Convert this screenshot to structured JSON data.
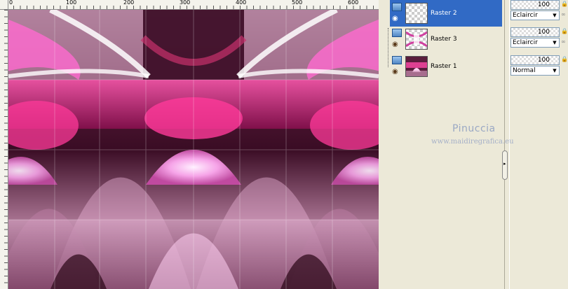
{
  "ruler": {
    "labels": [
      "0",
      "100",
      "200",
      "300",
      "400",
      "500",
      "600"
    ]
  },
  "layers": [
    {
      "name": "Raster 2",
      "selected": true,
      "opacity": "100",
      "blend": "Eclaircir"
    },
    {
      "name": "Raster 3",
      "selected": false,
      "opacity": "100",
      "blend": "Eclaircir"
    },
    {
      "name": "Raster 1",
      "selected": false,
      "opacity": "100",
      "blend": "Normal"
    }
  ],
  "watermark": {
    "name": "Pinuccia",
    "url": "www.maidiregrafica.eu"
  },
  "icons": {
    "layer": "raster-layer-icon",
    "eye": "eye-icon",
    "lock": "lock-icon",
    "link": "link-icon",
    "collapse": "chevron-right-icon"
  },
  "colors": {
    "selection": "#316ac5",
    "panel_bg": "#ece9d8"
  }
}
